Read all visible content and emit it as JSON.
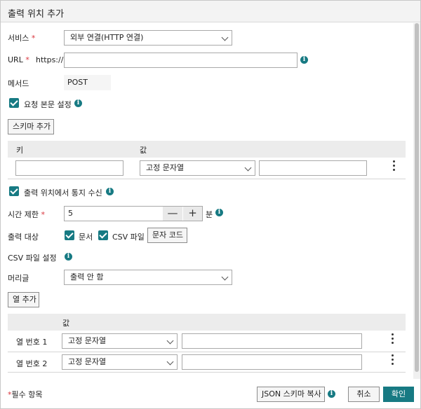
{
  "title": "출력 위치 추가",
  "service": {
    "label": "서비스",
    "value": "외부 연결(HTTP 연결)"
  },
  "url": {
    "label": "URL",
    "prefix": "https://",
    "value": ""
  },
  "method": {
    "label": "메서드",
    "value": "POST"
  },
  "request_body": {
    "label": "요청 본문 설정"
  },
  "add_schema_button": "스키마 추가",
  "schema_table": {
    "col_key": "키",
    "col_value": "값",
    "rows": [
      {
        "key": "",
        "type": "고정 문자열",
        "value": ""
      }
    ]
  },
  "notify": {
    "label": "출력 위치에서 통지 수신"
  },
  "timeout": {
    "label": "시간 제한",
    "value": "5",
    "unit": "분",
    "minus": "—",
    "plus": "+"
  },
  "output_target": {
    "label": "출력 대상",
    "document_label": "문서",
    "csv_label": "CSV 파일",
    "char_code_button": "문자 코드"
  },
  "csv_settings": {
    "label": "CSV 파일 설정"
  },
  "header": {
    "label": "머리글",
    "value": "출력 안 함"
  },
  "add_column_button": "열 추가",
  "column_table": {
    "col_value": "값",
    "rows": [
      {
        "label": "열 번호 1",
        "type": "고정 문자열",
        "value": ""
      },
      {
        "label": "열 번호 2",
        "type": "고정 문자열",
        "value": ""
      }
    ]
  },
  "footer": {
    "required_mark": "*",
    "required_note": "필수 항목",
    "json_schema_copy_button": "JSON 스키마 복사",
    "cancel_button": "취소",
    "ok_button": "확인"
  },
  "colors": {
    "accent": "#177a83",
    "required": "#d9363e"
  }
}
